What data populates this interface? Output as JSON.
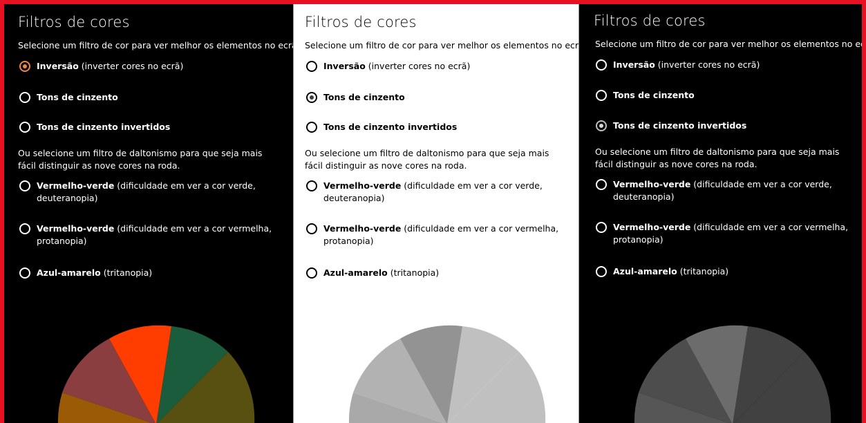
{
  "panels": [
    {
      "title": "Filtros de cores",
      "description": "Selecione um filtro de cor para ver melhor os elementos no ecrã",
      "options": [
        {
          "bold": "Inversão",
          "rest": " (inverter cores no ecrã)",
          "selected": true
        },
        {
          "bold": "Tons de cinzento",
          "rest": "",
          "selected": false
        },
        {
          "bold": "Tons de cinzento invertidos",
          "rest": "",
          "selected": false
        }
      ],
      "colorblind_description": "Ou selecione um filtro de daltonismo para que seja mais fácil distinguir as nove cores na roda.",
      "colorblind_options": [
        {
          "bold": "Vermelho-verde",
          "rest": " (dificuldade em ver a cor verde, deuteranopia)",
          "selected": false
        },
        {
          "bold": "Vermelho-verde",
          "rest": " (dificuldade em ver a cor vermelha, protanopia)",
          "selected": false
        },
        {
          "bold": "Azul-amarelo",
          "rest": " (tritanopia)",
          "selected": false
        }
      ],
      "wheel_colors": [
        "#1b5c3c",
        "#575010",
        "#9a5a06",
        "#8a3e40",
        "#ff3d00"
      ]
    },
    {
      "title": "Filtros de cores",
      "description": "Selecione um filtro de cor para ver melhor os elementos no ecrã",
      "options": [
        {
          "bold": "Inversão",
          "rest": " (inverter cores no ecrã)",
          "selected": false
        },
        {
          "bold": "Tons de cinzento",
          "rest": "",
          "selected": true
        },
        {
          "bold": "Tons de cinzento invertidos",
          "rest": "",
          "selected": false
        }
      ],
      "colorblind_description": "Ou selecione um filtro de daltonismo para que seja mais fácil distinguir as nove cores na roda.",
      "colorblind_options": [
        {
          "bold": "Vermelho-verde",
          "rest": " (dificuldade em ver a cor verde, deuteranopia)",
          "selected": false
        },
        {
          "bold": "Vermelho-verde",
          "rest": " (dificuldade em ver a cor vermelha, protanopia)",
          "selected": false
        },
        {
          "bold": "Azul-amarelo",
          "rest": " (tritanopia)",
          "selected": false
        }
      ],
      "wheel_colors": [
        "#c0c0c0",
        "#b2b2b2",
        "#a9a9a9",
        "#a0a0a0",
        "#939393"
      ]
    },
    {
      "title": "Filtros de cores",
      "description": "Selecione um filtro de cor para ver melhor os elementos no ecrã",
      "options": [
        {
          "bold": "Inversão",
          "rest": " (inverter cores no ecrã)",
          "selected": false
        },
        {
          "bold": "Tons de cinzento",
          "rest": "",
          "selected": false
        },
        {
          "bold": "Tons de cinzento invertidos",
          "rest": "",
          "selected": true
        }
      ],
      "colorblind_description": "Ou selecione um filtro de daltonismo para que seja mais fácil distinguir as nove cores na roda.",
      "colorblind_options": [
        {
          "bold": "Vermelho-verde",
          "rest": " (dificuldade em ver a cor verde, deuteranopia)",
          "selected": false
        },
        {
          "bold": "Vermelho-verde",
          "rest": " (dificuldade em ver a cor vermelha, protanopia)",
          "selected": false
        },
        {
          "bold": "Azul-amarelo",
          "rest": " (tritanopia)",
          "selected": false
        }
      ],
      "wheel_colors": [
        "#414141",
        "#4d4d4d",
        "#565656",
        "#5f5f5f",
        "#6c6c6c"
      ]
    }
  ]
}
